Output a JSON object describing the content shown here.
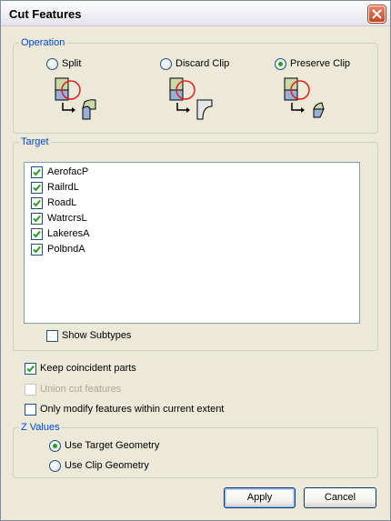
{
  "window": {
    "title": "Cut Features"
  },
  "operation": {
    "legend": "Operation",
    "options": [
      {
        "label": "Split",
        "checked": false
      },
      {
        "label": "Discard Clip",
        "checked": false
      },
      {
        "label": "Preserve Clip",
        "checked": true
      }
    ]
  },
  "target": {
    "legend": "Target",
    "layers": [
      {
        "name": "AerofacP",
        "checked": true
      },
      {
        "name": "RailrdL",
        "checked": true
      },
      {
        "name": "RoadL",
        "checked": true
      },
      {
        "name": "WatrcrsL",
        "checked": true
      },
      {
        "name": "LakeresA",
        "checked": true
      },
      {
        "name": "PolbndA",
        "checked": true
      }
    ],
    "show_subtypes": {
      "label": "Show Subtypes",
      "checked": false
    }
  },
  "options": {
    "keep_coincident": {
      "label": "Keep coincident parts",
      "checked": true,
      "enabled": true
    },
    "union_cut": {
      "label": "Union cut features",
      "checked": false,
      "enabled": false
    },
    "only_modify": {
      "label": "Only modify features within current extent",
      "checked": false,
      "enabled": true
    }
  },
  "z_values": {
    "legend": "Z Values",
    "options": [
      {
        "label": "Use Target Geometry",
        "checked": true
      },
      {
        "label": "Use Clip Geometry",
        "checked": false
      }
    ]
  },
  "buttons": {
    "apply": "Apply",
    "cancel": "Cancel"
  },
  "colors": {
    "accent_legend": "#0046d5",
    "check_mark": "#21a121",
    "clip_circle": "#e02020"
  },
  "icons": [
    "close-icon",
    "split-diagram-icon",
    "discard-clip-diagram-icon",
    "preserve-clip-diagram-icon",
    "check-mark-icon"
  ]
}
